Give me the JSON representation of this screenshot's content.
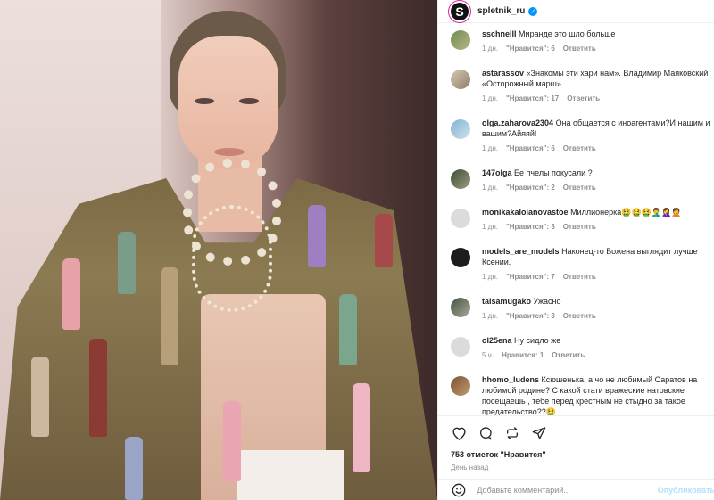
{
  "post": {
    "username": "spletnik_ru",
    "logo_letter": "S"
  },
  "comments": [
    {
      "user": "sschnelll",
      "text": "Миранде это шло больше",
      "time": "1 дн.",
      "likes": "\"Нравится\": 6",
      "reply": "Ответить"
    },
    {
      "user": "astarassov",
      "text": "«Знакомы эти хари нам». Владимир Маяковский «Осторожный марш»",
      "time": "1 дн.",
      "likes": "\"Нравится\": 17",
      "reply": "Ответить"
    },
    {
      "user": "olga.zaharova2304",
      "text": "Она общается с иноагентами?И нашим и вашим?Айяяй!",
      "time": "1 дн.",
      "likes": "\"Нравится\": 6",
      "reply": "Ответить"
    },
    {
      "user": "147olga",
      "text": "Ее пчелы покусали ?",
      "time": "1 дн.",
      "likes": "\"Нравится\": 2",
      "reply": "Ответить"
    },
    {
      "user": "monikakaloianovastoe",
      "text": "Миллионерка🤮🤮🤮🤦‍♂️🤦‍♀️🤦",
      "time": "1 дн.",
      "likes": "\"Нравится\": 3",
      "reply": "Ответить"
    },
    {
      "user": "models_are_models",
      "text": "Наконец-то Божена выглядит лучше Ксении.",
      "time": "1 дн.",
      "likes": "\"Нравится\": 7",
      "reply": "Ответить"
    },
    {
      "user": "taisamugako",
      "text": "Ужасно",
      "time": "1 дн.",
      "likes": "\"Нравится\": 3",
      "reply": "Ответить"
    },
    {
      "user": "ol25ena",
      "text": "Ну сидло же",
      "time": "5 ч.",
      "likes": "Нравится: 1",
      "reply": "Ответить"
    },
    {
      "user": "hhomo_ludens",
      "text": "Ксюшенька, а чо не любимый Саратов на любимой родине? С какой стати вражеские натовские посещаешь , тебе перед крестным не стыдно за такое предательство??🤮",
      "time": "",
      "likes": "",
      "reply": ""
    }
  ],
  "actions": {
    "like_count": "753 отметок \"Нравится\"",
    "timestamp": "День назад",
    "comment_placeholder": "Добавьте комментарий...",
    "publish_label": "Опубликовать"
  },
  "icons": [
    "heart-icon",
    "comment-icon",
    "repost-icon",
    "share-icon",
    "emoji-icon"
  ],
  "colors": {
    "verified": "#0095f6",
    "muted": "#8e8e8e",
    "publish": "#b2dffc"
  }
}
